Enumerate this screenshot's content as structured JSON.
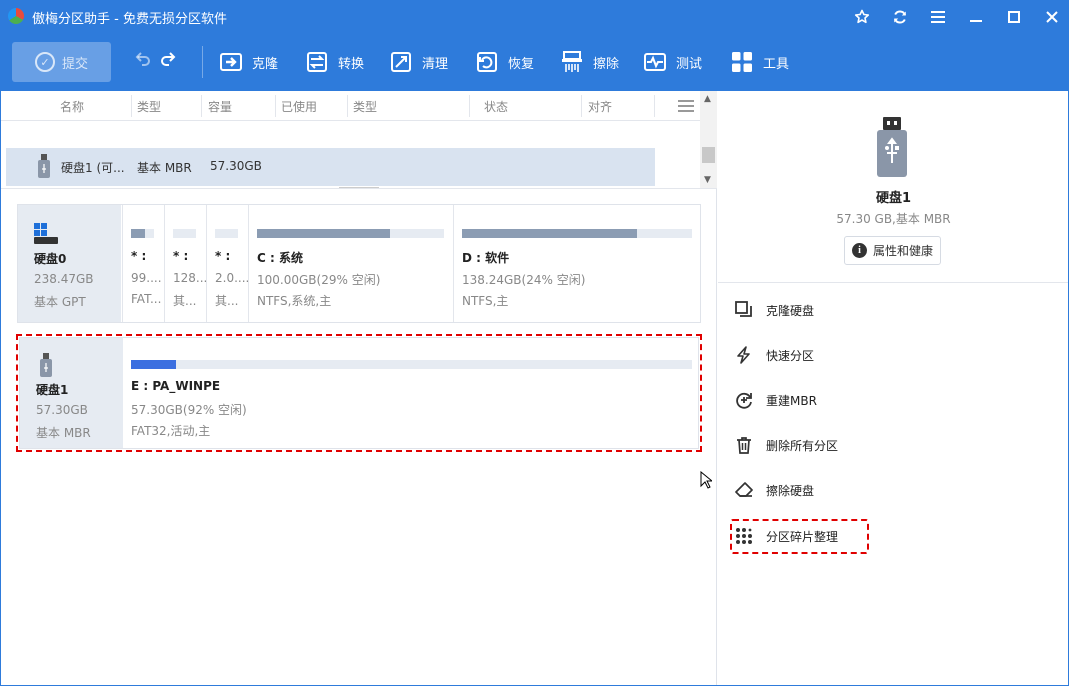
{
  "window": {
    "title": "傲梅分区助手 - 免费无损分区软件"
  },
  "toolbar": {
    "submit": "提交",
    "items": [
      "克隆",
      "转换",
      "清理",
      "恢复",
      "擦除",
      "测试",
      "工具"
    ]
  },
  "columns": [
    "名称",
    "类型",
    "容量",
    "已使用",
    "类型",
    "状态",
    "对齐"
  ],
  "disk_list": {
    "selected_row": {
      "name": "硬盘1 (可...",
      "type": "基本 MBR",
      "capacity": "57.30GB"
    }
  },
  "disks": [
    {
      "name": "硬盘0",
      "size": "238.47GB",
      "type": "基本 GPT",
      "partitions": [
        {
          "name": "* :",
          "size": "99....",
          "fs": "FAT...",
          "used_fraction": 0.6
        },
        {
          "name": "* :",
          "size": "128....",
          "fs": "其...",
          "used_fraction": 0.0
        },
        {
          "name": "* :",
          "size": "2.0....",
          "fs": "其...",
          "used_fraction": 0.0
        },
        {
          "name": "C : 系统",
          "size": "100.00GB(29% 空闲)",
          "fs": "NTFS,系统,主",
          "used_fraction": 0.71
        },
        {
          "name": "D : 软件",
          "size": "138.24GB(24% 空闲)",
          "fs": "NTFS,主",
          "used_fraction": 0.76
        }
      ]
    },
    {
      "name": "硬盘1",
      "size": "57.30GB",
      "type": "基本 MBR",
      "partitions": [
        {
          "name": "E : PA_WINPE",
          "size": "57.30GB(92% 空闲)",
          "fs": "FAT32,活动,主",
          "used_fraction": 0.08
        }
      ]
    }
  ],
  "right_panel": {
    "disk_name": "硬盘1",
    "disk_info": "57.30 GB,基本 MBR",
    "properties_button": "属性和健康",
    "operations": [
      "克隆硬盘",
      "快速分区",
      "重建MBR",
      "删除所有分区",
      "擦除硬盘",
      "分区碎片整理"
    ]
  },
  "colors": {
    "accent": "#2e7bdb",
    "bar_used_gray": "#8b9cb3",
    "bar_used_blue": "#3b6fe0",
    "highlight": "#e00000"
  }
}
